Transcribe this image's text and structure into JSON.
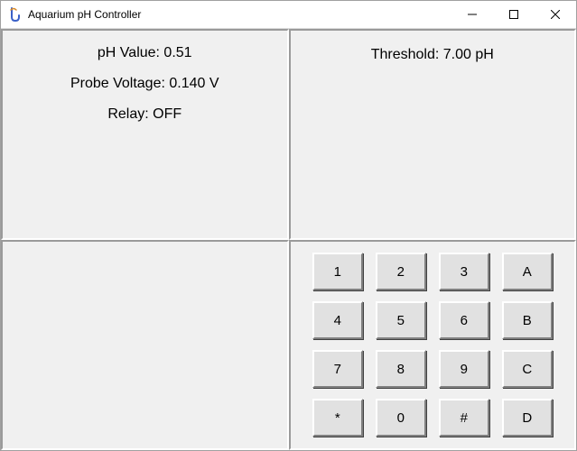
{
  "window": {
    "title": "Aquarium pH Controller"
  },
  "status": {
    "ph_label": "pH Value: 0.51",
    "voltage_label": "Probe Voltage: 0.140 V",
    "relay_label": "Relay: OFF"
  },
  "threshold": {
    "label": "Threshold: 7.00 pH"
  },
  "keypad": {
    "keys": [
      [
        "1",
        "2",
        "3",
        "A"
      ],
      [
        "4",
        "5",
        "6",
        "B"
      ],
      [
        "7",
        "8",
        "9",
        "C"
      ],
      [
        "*",
        "0",
        "#",
        "D"
      ]
    ]
  }
}
